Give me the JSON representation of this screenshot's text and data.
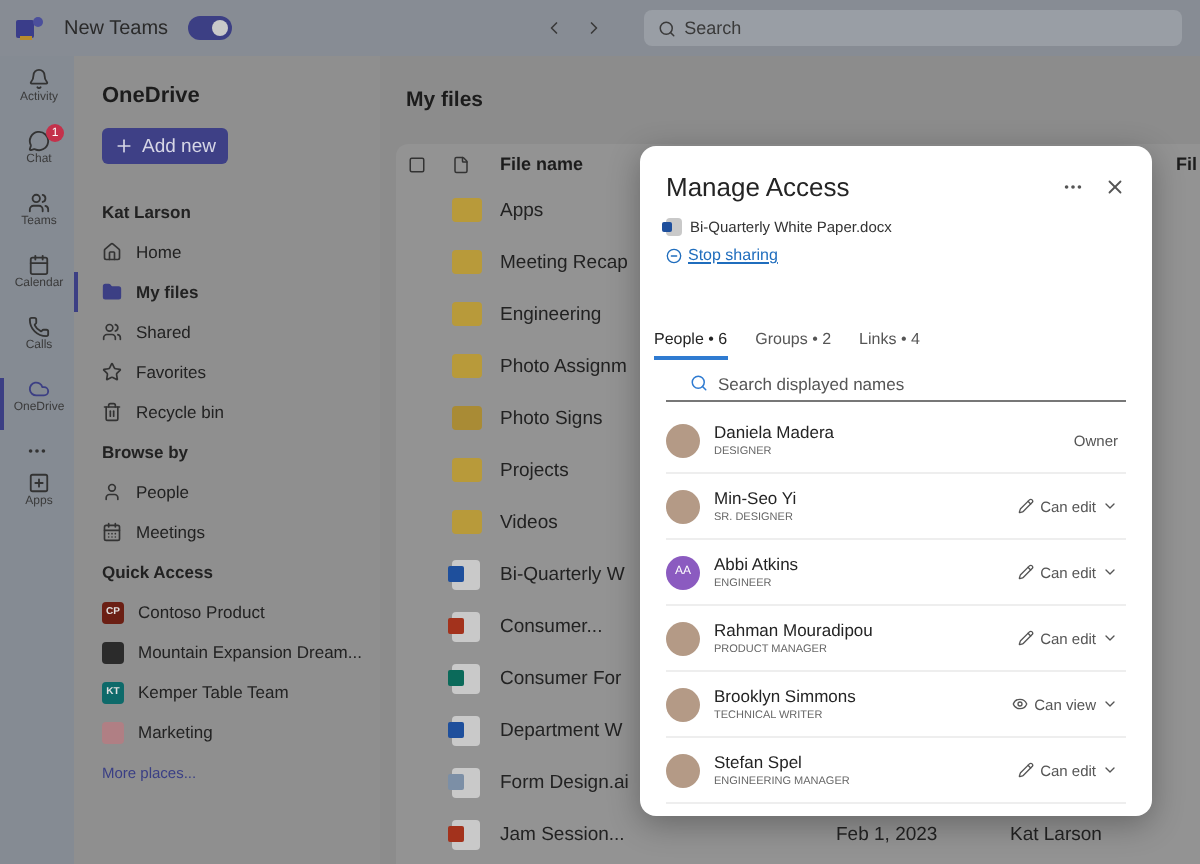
{
  "top_bar": {
    "toggle_label": "New Teams",
    "toggle_on": true,
    "search_placeholder": "Search"
  },
  "rail": {
    "items": [
      {
        "kind": "activity",
        "label": "Activity",
        "selected": false
      },
      {
        "kind": "chat",
        "label": "Chat",
        "selected": false,
        "badge": "1"
      },
      {
        "kind": "teams",
        "label": "Teams",
        "selected": false
      },
      {
        "kind": "calendar",
        "label": "Calendar",
        "selected": false
      },
      {
        "kind": "calls",
        "label": "Calls",
        "selected": false
      },
      {
        "kind": "onedrive",
        "label": "OneDrive",
        "selected": true
      }
    ],
    "apps_label": "Apps"
  },
  "sidebar": {
    "title": "OneDrive",
    "add_button": "Add new",
    "user": "Kat Larson",
    "nav": [
      {
        "kind": "home",
        "label": "Home",
        "selected": false
      },
      {
        "kind": "files",
        "label": "My files",
        "selected": true
      },
      {
        "kind": "shared",
        "label": "Shared",
        "selected": false
      },
      {
        "kind": "favorites",
        "label": "Favorites",
        "selected": false
      },
      {
        "kind": "recycle",
        "label": "Recycle bin",
        "selected": false
      }
    ],
    "browse_heading": "Browse by",
    "browse": [
      {
        "kind": "people",
        "label": "People"
      },
      {
        "kind": "meetings",
        "label": "Meetings"
      }
    ],
    "quick_heading": "Quick Access",
    "quick": [
      {
        "label": "Contoso Product",
        "initials": "CP",
        "color": "#6b1f14"
      },
      {
        "label": "Mountain Expansion Dream...",
        "color": "#2b2b2b"
      },
      {
        "label": "Kemper Table Team",
        "initials": "KT",
        "color": "#0e6a6a"
      },
      {
        "label": "Marketing",
        "color": "#b07f84"
      }
    ],
    "more_link": "More places..."
  },
  "main": {
    "title": "My files",
    "columns": [
      "File name",
      "Fil"
    ],
    "rows": [
      {
        "kind": "folder",
        "name": "Apps"
      },
      {
        "kind": "folder",
        "name": "Meeting Recap"
      },
      {
        "kind": "folder",
        "name": "Engineering"
      },
      {
        "kind": "folder",
        "name": "Photo Assignm"
      },
      {
        "kind": "shared-folder",
        "name": "Photo Signs"
      },
      {
        "kind": "folder",
        "name": "Projects"
      },
      {
        "kind": "folder",
        "name": "Videos"
      },
      {
        "kind": "word",
        "name": "Bi-Quarterly W"
      },
      {
        "kind": "ppt",
        "name": "Consumer..."
      },
      {
        "kind": "forms",
        "name": "Consumer For"
      },
      {
        "kind": "word",
        "name": "Department W"
      },
      {
        "kind": "image",
        "name": "Form Design.ai"
      },
      {
        "kind": "ppt",
        "name": "Jam Session...",
        "date": "Feb 1, 2023",
        "owner": "Kat Larson"
      }
    ]
  },
  "dialog": {
    "title": "Manage Access",
    "file": "Bi-Quarterly White Paper.docx",
    "stop_sharing": "Stop sharing",
    "tabs": [
      {
        "label": "People • 6",
        "selected": true
      },
      {
        "label": "Groups • 2",
        "selected": false
      },
      {
        "label": "Links • 4",
        "selected": false
      }
    ],
    "search_placeholder": "Search displayed names",
    "people": [
      {
        "name": "Daniela Madera",
        "role": "DESIGNER",
        "kind": "owner",
        "permission": "Owner"
      },
      {
        "name": "Min-Seo Yi",
        "role": "SR. DESIGNER",
        "kind": "edit",
        "permission": "Can edit"
      },
      {
        "name": "Abbi Atkins",
        "role": "ENGINEER",
        "initials": "AA",
        "kind": "edit",
        "permission": "Can edit"
      },
      {
        "name": "Rahman Mouradipou",
        "role": "PRODUCT MANAGER",
        "kind": "edit",
        "permission": "Can edit"
      },
      {
        "name": "Brooklyn Simmons",
        "role": "TECHNICAL WRITER",
        "kind": "view",
        "permission": "Can view"
      },
      {
        "name": "Stefan Spel",
        "role": "ENGINEERING MANAGER",
        "kind": "edit",
        "permission": "Can edit"
      }
    ]
  }
}
